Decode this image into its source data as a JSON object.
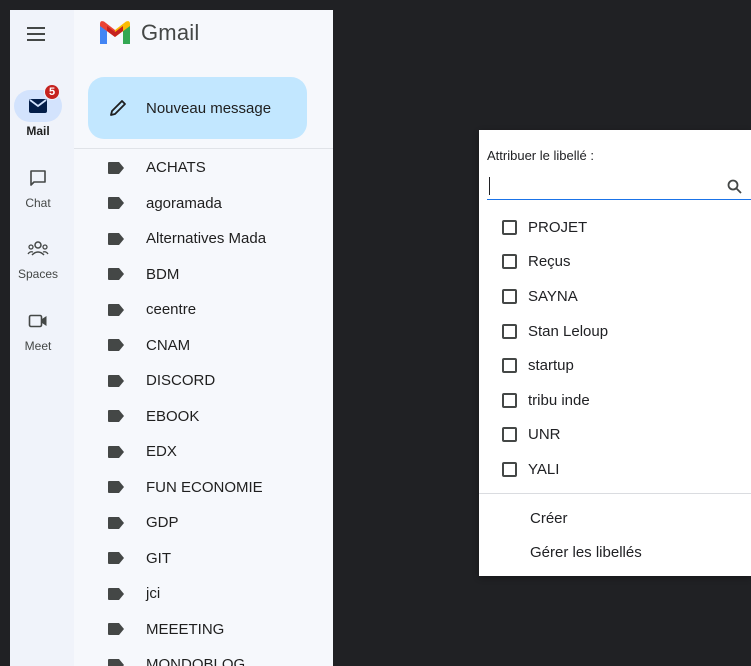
{
  "app": {
    "brand": "Gmail",
    "compose_label": "Nouveau message"
  },
  "rail": {
    "items": [
      {
        "label": "Mail",
        "badge": "5",
        "icon": "mail-icon",
        "active": true
      },
      {
        "label": "Chat",
        "icon": "chat-icon"
      },
      {
        "label": "Spaces",
        "icon": "spaces-icon"
      },
      {
        "label": "Meet",
        "icon": "meet-icon"
      }
    ]
  },
  "labels": [
    {
      "name": "ACHATS"
    },
    {
      "name": "agoramada"
    },
    {
      "name": "Alternatives Mada"
    },
    {
      "name": "BDM"
    },
    {
      "name": "ceentre"
    },
    {
      "name": "CNAM"
    },
    {
      "name": "DISCORD"
    },
    {
      "name": "EBOOK"
    },
    {
      "name": "EDX"
    },
    {
      "name": "FUN ECONOMIE"
    },
    {
      "name": "GDP"
    },
    {
      "name": "GIT"
    },
    {
      "name": "jci"
    },
    {
      "name": "MEEETING"
    },
    {
      "name": "MONDOBLOG"
    }
  ],
  "popup": {
    "title": "Attribuer le libellé :",
    "search_value": "",
    "options": [
      {
        "label": "PROJET",
        "checked": false
      },
      {
        "label": "Reçus",
        "checked": false
      },
      {
        "label": "SAYNA",
        "checked": false
      },
      {
        "label": "Stan Leloup",
        "checked": false
      },
      {
        "label": "startup",
        "checked": false
      },
      {
        "label": "tribu inde",
        "checked": false
      },
      {
        "label": "UNR",
        "checked": false
      },
      {
        "label": "YALI",
        "checked": false
      }
    ],
    "create_label": "Créer",
    "manage_label": "Gérer les libellés"
  },
  "colors": {
    "accent": "#1a73e8",
    "compose_bg": "#c2e7ff",
    "badge": "#c5221f"
  }
}
